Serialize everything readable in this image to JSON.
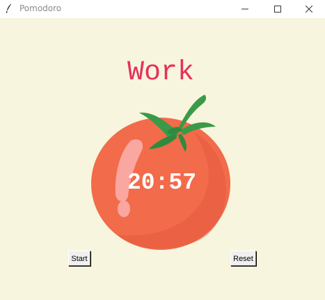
{
  "window": {
    "title": "Pomodoro",
    "icon": "feather-icon",
    "controls": [
      "minimize-icon",
      "maximize-icon",
      "close-icon"
    ]
  },
  "heading": "Work",
  "timer": "20:57",
  "buttons": {
    "start_label": "Start",
    "reset_label": "Reset"
  },
  "colors": {
    "background": "#f7f5dd",
    "heading": "#e7305b",
    "tomato": "#f26b4a",
    "leaf": "#3a9a48",
    "timer_text": "#ffffff"
  }
}
